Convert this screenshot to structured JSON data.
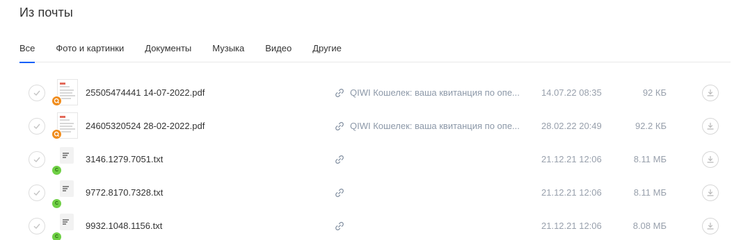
{
  "page": {
    "title": "Из почты"
  },
  "tabs": [
    {
      "label": "Все",
      "active": true
    },
    {
      "label": "Фото и картинки",
      "active": false
    },
    {
      "label": "Документы",
      "active": false
    },
    {
      "label": "Музыка",
      "active": false
    },
    {
      "label": "Видео",
      "active": false
    },
    {
      "label": "Другие",
      "active": false
    }
  ],
  "colors": {
    "accent": "#005ff9",
    "badge_qiwi": "#f08c1c",
    "badge_c": "#6fd045",
    "muted_text": "#98a0ac"
  },
  "files": [
    {
      "name": "25505474441 14-07-2022.pdf",
      "type": "pdf",
      "source_badge": "qiwi-badge-icon",
      "subject": "QIWI Кошелек: ваша квитанция по опе...",
      "date": "14.07.22 08:35",
      "size": "92 КБ"
    },
    {
      "name": "24605320524 28-02-2022.pdf",
      "type": "pdf",
      "source_badge": "qiwi-badge-icon",
      "subject": "QIWI Кошелек: ваша квитанция по опе...",
      "date": "28.02.22 20:49",
      "size": "92.2 КБ"
    },
    {
      "name": "3146.1279.7051.txt",
      "type": "txt",
      "source_badge": "c-badge-icon",
      "badge_letter": "C",
      "subject": "",
      "date": "21.12.21 12:06",
      "size": "8.11 МБ"
    },
    {
      "name": "9772.8170.7328.txt",
      "type": "txt",
      "source_badge": "c-badge-icon",
      "badge_letter": "C",
      "subject": "",
      "date": "21.12.21 12:06",
      "size": "8.11 МБ"
    },
    {
      "name": "9932.1048.1156.txt",
      "type": "txt",
      "source_badge": "c-badge-icon",
      "badge_letter": "C",
      "subject": "",
      "date": "21.12.21 12:06",
      "size": "8.08 МБ"
    }
  ]
}
